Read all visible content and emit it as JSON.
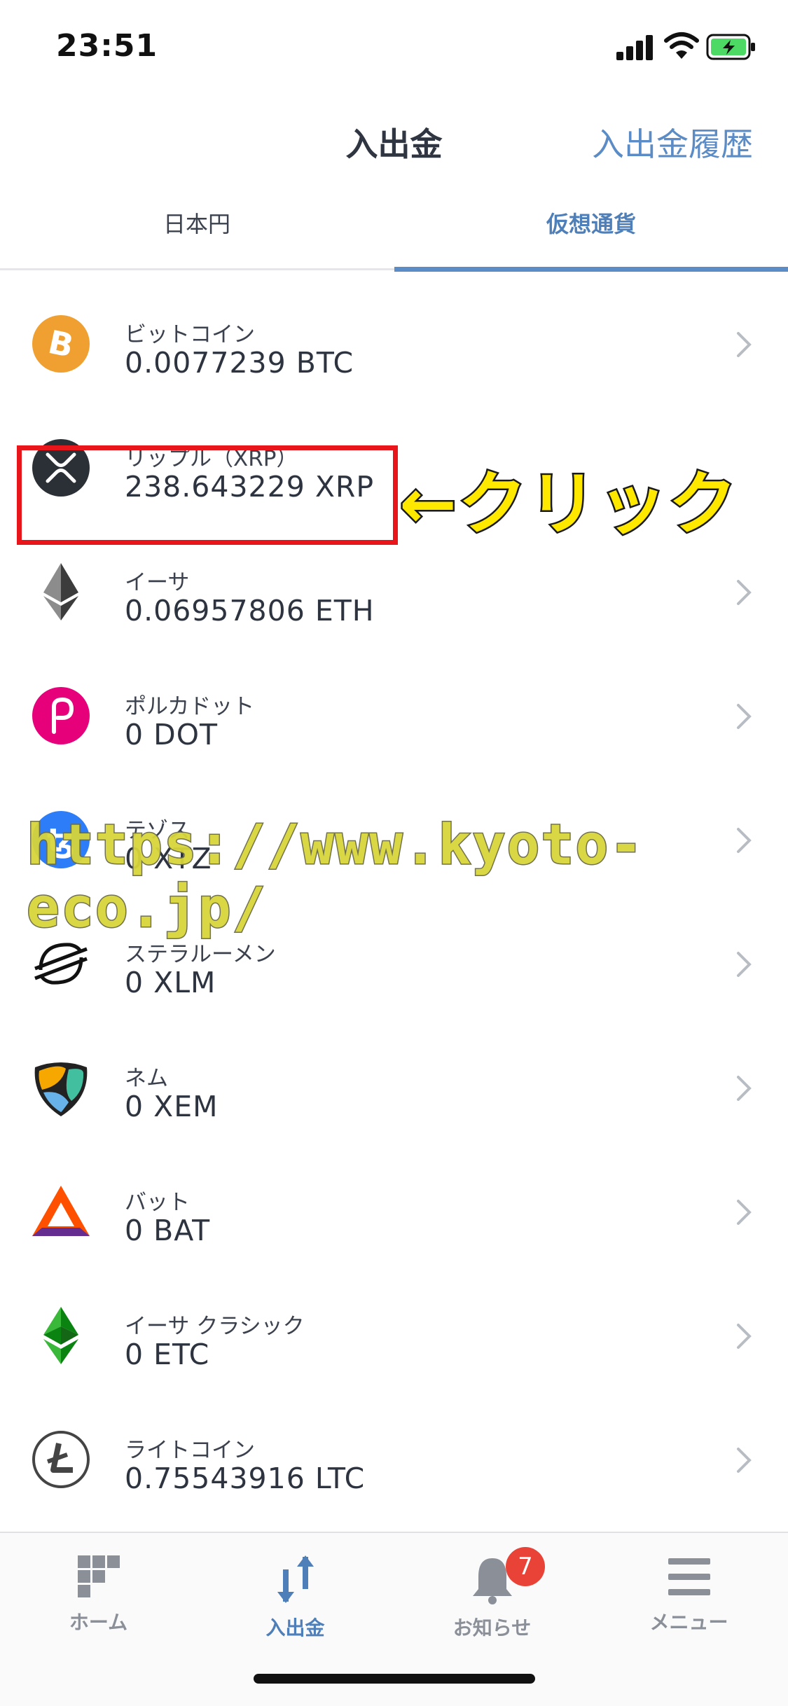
{
  "status_bar": {
    "time": "23:51"
  },
  "header": {
    "title": "入出金",
    "history_link": "入出金履歴"
  },
  "tabs": [
    {
      "label": "日本円"
    },
    {
      "label": "仮想通貨"
    }
  ],
  "coins": [
    {
      "name": "ビットコイン",
      "amount": "0.0077239 BTC",
      "icon": "bitcoin-icon",
      "color": "#f0a030"
    },
    {
      "name": "リップル（XRP）",
      "amount": "238.643229 XRP",
      "icon": "xrp-icon",
      "color": "#2b2f36"
    },
    {
      "name": "イーサ",
      "amount": "0.06957806 ETH",
      "icon": "ethereum-icon",
      "color": "#3c3c3d"
    },
    {
      "name": "ポルカドット",
      "amount": "0 DOT",
      "icon": "polkadot-icon",
      "color": "#e6007a"
    },
    {
      "name": "テゾス",
      "amount": "0 XTZ",
      "icon": "tezos-icon",
      "color": "#2c7df7"
    },
    {
      "name": "ステラルーメン",
      "amount": "0 XLM",
      "icon": "stellar-icon",
      "color": "#111111"
    },
    {
      "name": "ネム",
      "amount": "0 XEM",
      "icon": "nem-icon",
      "color": "#41bf9f"
    },
    {
      "name": "バット",
      "amount": "0 BAT",
      "icon": "bat-icon",
      "color": "#ff5000"
    },
    {
      "name": "イーサ クラシック",
      "amount": "0 ETC",
      "icon": "ethereum-classic-icon",
      "color": "#328332"
    },
    {
      "name": "ライトコイン",
      "amount": "0.75543916 LTC",
      "icon": "litecoin-icon",
      "color": "#5a5a5a"
    }
  ],
  "annotation": {
    "text": "←クリック"
  },
  "watermark": {
    "text": "https://www.kyoto-eco.jp/"
  },
  "tab_bar": {
    "items": [
      {
        "label": "ホーム",
        "icon": "home-icon"
      },
      {
        "label": "入出金",
        "icon": "transfer-icon"
      },
      {
        "label": "お知らせ",
        "icon": "bell-icon",
        "badge": "7"
      },
      {
        "label": "メニュー",
        "icon": "menu-icon"
      }
    ]
  },
  "colors": {
    "accent": "#5b8cc5",
    "highlight": "#e8161b",
    "annotation": "#ffe800",
    "badge": "#e84336"
  }
}
